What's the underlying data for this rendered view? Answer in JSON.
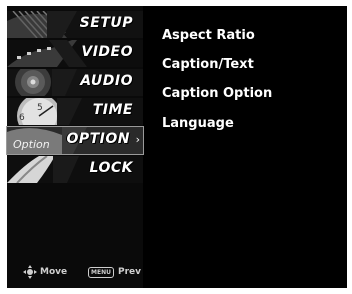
{
  "menu": {
    "items": [
      {
        "label": "SETUP",
        "icon": "setup-photo-icon"
      },
      {
        "label": "VIDEO",
        "icon": "video-photo-icon"
      },
      {
        "label": "AUDIO",
        "icon": "audio-photo-icon"
      },
      {
        "label": "TIME",
        "icon": "time-photo-icon"
      },
      {
        "label": "OPTION",
        "icon": "option-photo-icon",
        "selected": true,
        "art_text": "Option"
      },
      {
        "label": "LOCK",
        "icon": "lock-photo-icon"
      }
    ]
  },
  "submenu": {
    "items": [
      "Aspect Ratio",
      "Caption/Text",
      "Caption Option",
      "Language"
    ]
  },
  "footer": {
    "move_label": "Move",
    "menu_key": "MENU",
    "prev_label": "Prev"
  },
  "colors": {
    "background": "#000000",
    "text": "#ffffff",
    "selected_outline": "#9a9a9a"
  }
}
